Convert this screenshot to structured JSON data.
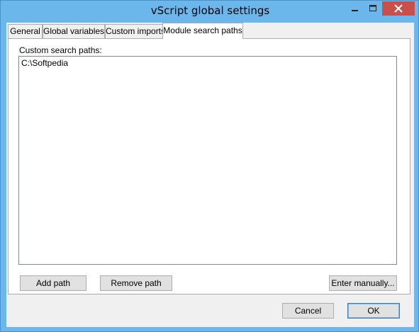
{
  "window": {
    "title": "vScript global settings",
    "controls": {
      "minimize": "minimize-icon",
      "maximize": "maximize-icon",
      "close": "close-icon"
    },
    "colors": {
      "frame": "#6bb6ea",
      "close": "#c7504b",
      "client": "#f0f0f0"
    }
  },
  "tabs": [
    {
      "label": "General",
      "selected": false
    },
    {
      "label": "Global variables",
      "selected": false
    },
    {
      "label": "Custom imports",
      "selected": false
    },
    {
      "label": "Module search paths",
      "selected": true
    }
  ],
  "panel": {
    "label": "Custom search paths:",
    "paths": [
      "C:\\Softpedia"
    ],
    "buttons": {
      "add": "Add path",
      "remove": "Remove path",
      "manual": "Enter manually..."
    }
  },
  "footer": {
    "cancel": "Cancel",
    "ok": "OK"
  }
}
